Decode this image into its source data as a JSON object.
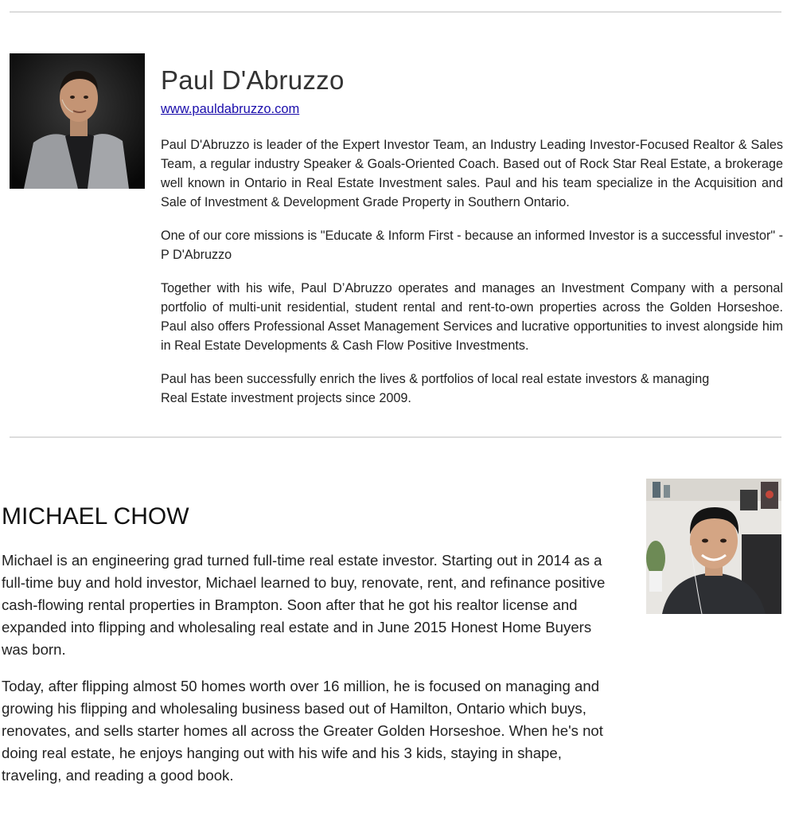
{
  "paul": {
    "photo_alt": "Paul D'Abruzzo photo",
    "name": "Paul D'Abruzzo",
    "website": "www.pauldabruzzo.com",
    "paragraphs": [
      "Paul D'Abruzzo is leader of the Expert Investor Team, an Industry Leading Investor-Focused Realtor & Sales Team, a regular industry Speaker & Goals-Oriented Coach. Based out of Rock Star Real Estate, a brokerage well known in Ontario in Real Estate Investment sales. Paul and his team specialize in the Acquisition and Sale of Investment & Development Grade Property in Southern Ontario.",
      "One of our core missions is \"Educate & Inform First - because an informed Investor is a successful investor\" -P D'Abruzzo",
      "Together with his wife, Paul D’Abruzzo operates and manages an Investment Company with a personal portfolio of multi-unit residential, student rental and rent-to-own properties across the Golden Horseshoe. Paul also offers Professional Asset Management Services and lucrative opportunities to invest alongside him in Real Estate Developments & Cash Flow Positive Investments.",
      "Paul has been successfully enrich the lives & portfolios of local real estate investors & managing Real Estate investment projects since 2009."
    ]
  },
  "michael": {
    "photo_alt": "Michael Chow photo",
    "name": "MICHAEL CHOW",
    "paragraphs": [
      "Michael is an engineering grad turned full-time real estate investor. Starting out in 2014 as a full-time buy and hold investor, Michael learned to buy, renovate, rent, and refinance positive cash-flowing rental properties in Brampton. Soon after that he got his realtor license and expanded into flipping and wholesaling real estate and in June 2015 Honest Home Buyers was born.",
      "Today, after flipping almost 50 homes worth over 16 million, he is focused on managing and growing his flipping and wholesaling business based out of Hamilton, Ontario which buys, renovates, and sells starter homes all across the Greater Golden Horseshoe. When he's not doing real estate, he enjoys hanging out with his wife and his 3 kids, staying in shape, traveling, and reading a good book."
    ]
  },
  "colors": {
    "link": "#1a0dab",
    "divider": "#dcdcdc",
    "text": "#222222"
  }
}
